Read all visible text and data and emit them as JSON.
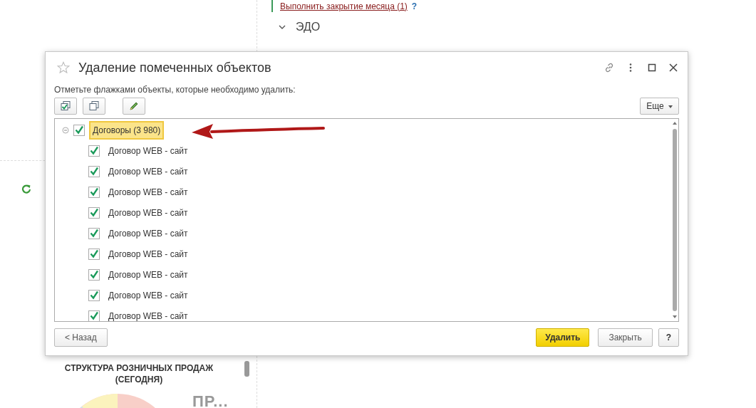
{
  "background": {
    "links": [
      {
        "text": "Выполнить закрытие месяца (1)",
        "help": "?"
      }
    ],
    "section": {
      "title": "ЭДО",
      "expanded": true
    },
    "chart": {
      "title": "СТРУКТУРА РОЗНИЧНЫХ ПРОДАЖ (СЕГОДНЯ)",
      "side_label": "ПР..."
    }
  },
  "dialog": {
    "title": "Удаление помеченных объектов",
    "hint": "Отметьте флажками объекты, которые необходимо удалить:",
    "more_button": "Еще",
    "tree": {
      "label": "Договоры (3 980)",
      "checked": true,
      "expanded": true,
      "highlighted": true,
      "children": [
        {
          "label": "Договор WEB - сайт",
          "checked": true
        },
        {
          "label": "Договор WEB - сайт",
          "checked": true
        },
        {
          "label": "Договор WEB - сайт",
          "checked": true
        },
        {
          "label": "Договор WEB - сайт",
          "checked": true
        },
        {
          "label": "Договор WEB - сайт",
          "checked": true
        },
        {
          "label": "Договор WEB - сайт",
          "checked": true
        },
        {
          "label": "Договор WEB - сайт",
          "checked": true
        },
        {
          "label": "Договор WEB - сайт",
          "checked": true
        },
        {
          "label": "Договор WEB - сайт",
          "checked": true
        }
      ]
    },
    "buttons": [
      {
        "label": "< Назад",
        "kind": "default"
      },
      {
        "label": "Удалить",
        "kind": "primary"
      },
      {
        "label": "Закрыть",
        "kind": "default"
      },
      {
        "label": "?",
        "kind": "help"
      }
    ]
  }
}
